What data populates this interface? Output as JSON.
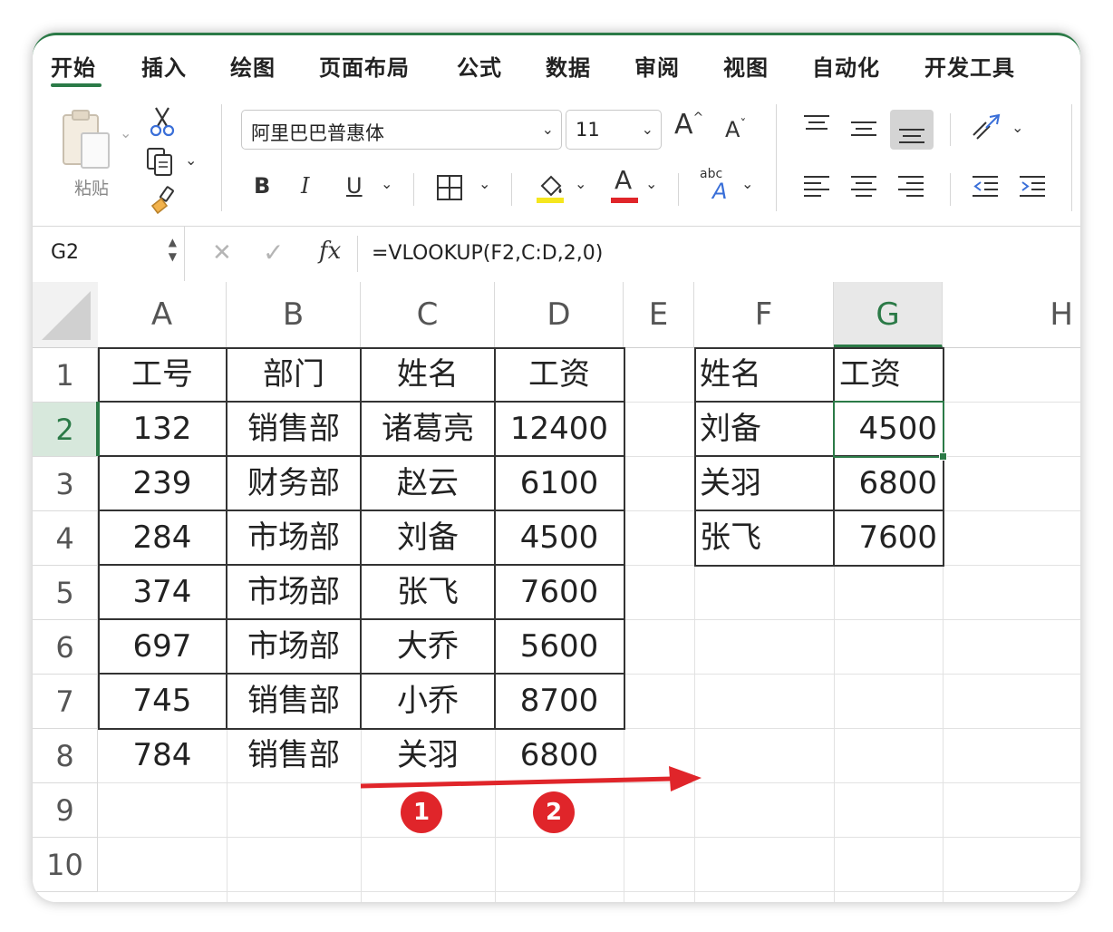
{
  "ribbon": {
    "tabs": [
      "开始",
      "插入",
      "绘图",
      "页面布局",
      "公式",
      "数据",
      "审阅",
      "视图",
      "自动化",
      "开发工具"
    ],
    "active_tab": "开始",
    "paste_label": "粘贴",
    "font_name": "阿里巴巴普惠体",
    "font_size": "11",
    "bold_label": "B",
    "italic_label": "I",
    "underline_label": "U",
    "font_grow": "A",
    "font_shrink": "A",
    "font_color_letter": "A",
    "wrap_letters": "abc",
    "accent_color": "#2b7a47",
    "highlight_color": "#f5e61e",
    "font_color": "#e0252a"
  },
  "formula_bar": {
    "cell_ref": "G2",
    "cancel_symbol": "✕",
    "enter_symbol": "✓",
    "fx_label": "fx",
    "formula": "=VLOOKUP(F2,C:D,2,0)"
  },
  "sheet": {
    "columns": [
      "A",
      "B",
      "C",
      "D",
      "E",
      "F",
      "G",
      "H"
    ],
    "rows": [
      "1",
      "2",
      "3",
      "4",
      "5",
      "6",
      "7",
      "8",
      "9",
      "10"
    ],
    "active_cell": "G2",
    "main_table": {
      "headers": [
        "工号",
        "部门",
        "姓名",
        "工资"
      ],
      "rows": [
        [
          "132",
          "销售部",
          "诸葛亮",
          "12400"
        ],
        [
          "239",
          "财务部",
          "赵云",
          "6100"
        ],
        [
          "284",
          "市场部",
          "刘备",
          "4500"
        ],
        [
          "374",
          "市场部",
          "张飞",
          "7600"
        ],
        [
          "697",
          "市场部",
          "大乔",
          "5600"
        ],
        [
          "745",
          "销售部",
          "小乔",
          "8700"
        ],
        [
          "784",
          "销售部",
          "关羽",
          "6800"
        ]
      ]
    },
    "lookup_table": {
      "headers": [
        "姓名",
        "工资"
      ],
      "rows": [
        [
          "刘备",
          "4500"
        ],
        [
          "关羽",
          "6800"
        ],
        [
          "张飞",
          "7600"
        ]
      ]
    },
    "annotation": {
      "arrow_color": "#e0252a",
      "badges": [
        "1",
        "2"
      ]
    }
  }
}
